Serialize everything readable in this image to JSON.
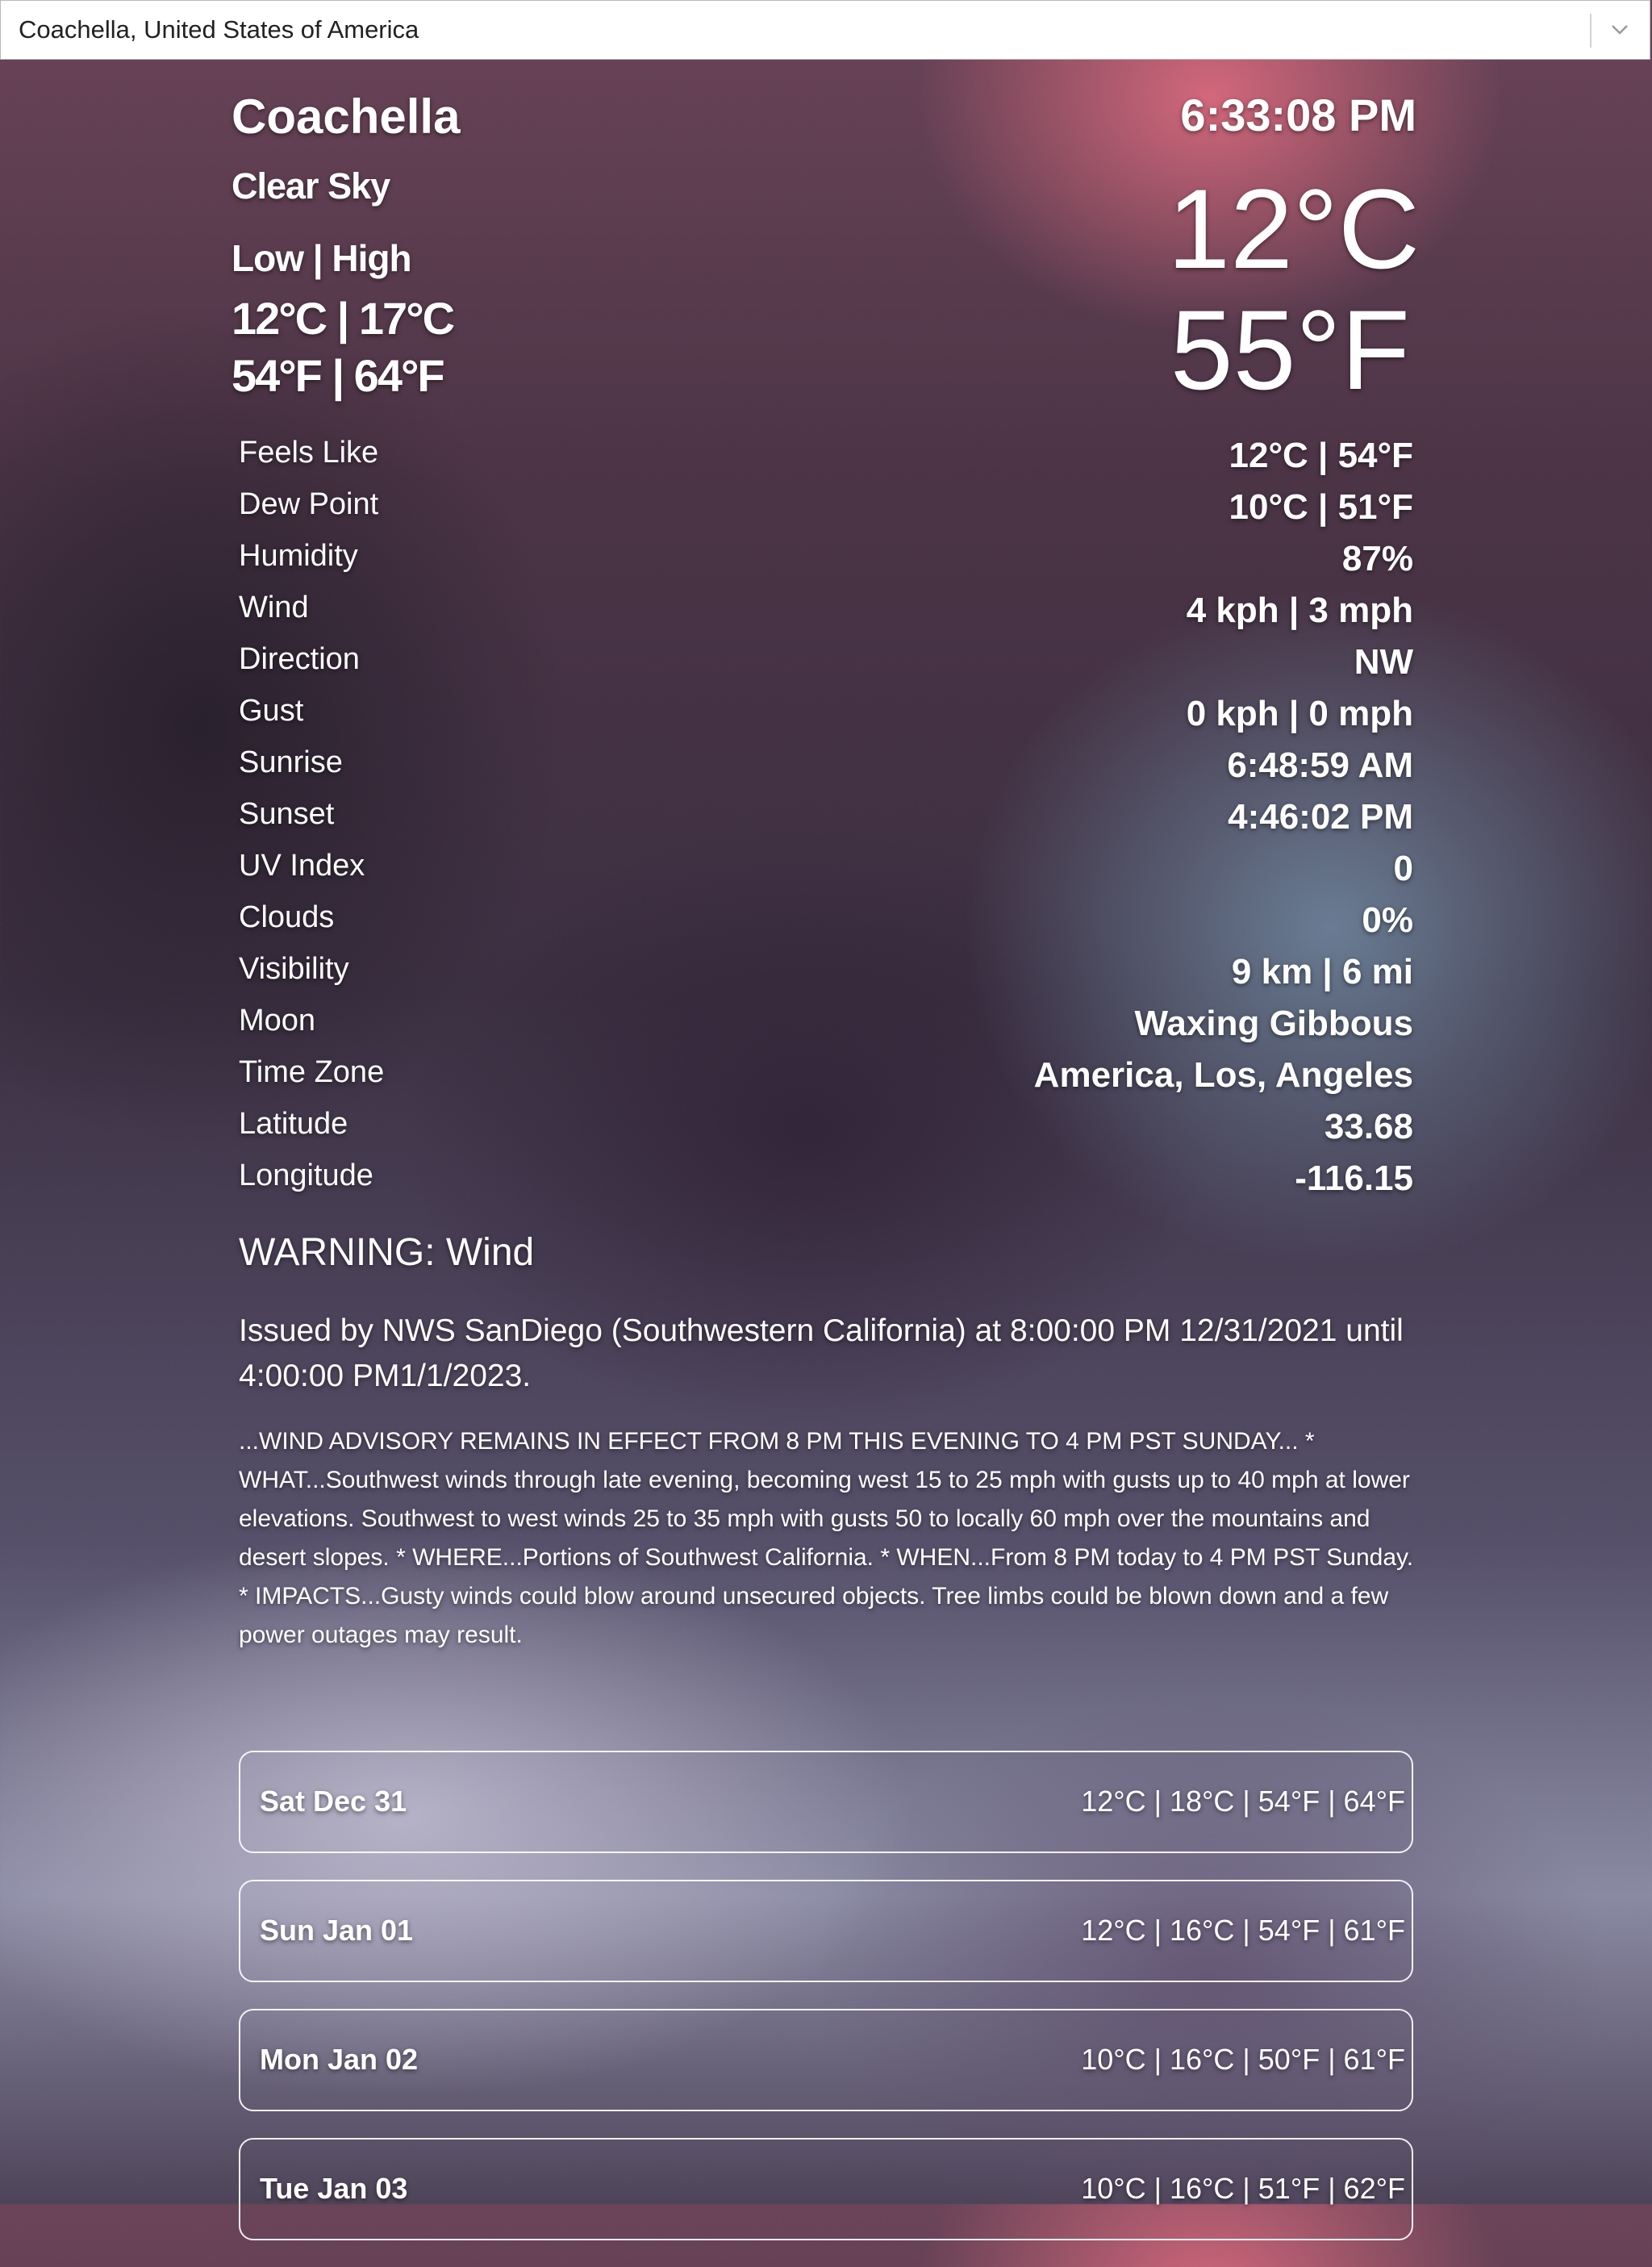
{
  "location_select": {
    "value": "Coachella, United States of America"
  },
  "current": {
    "city": "Coachella",
    "condition": "Clear Sky",
    "low_high_label": "Low | High",
    "low_high_c": "12°C | 17°C",
    "low_high_f": "54°F | 64°F",
    "time": "6:33:08 PM",
    "temp_c": "12°C",
    "temp_f": "55°F"
  },
  "details": [
    {
      "label": "Feels Like",
      "value": "12°C | 54°F"
    },
    {
      "label": "Dew Point",
      "value": "10°C | 51°F"
    },
    {
      "label": "Humidity",
      "value": "87%"
    },
    {
      "label": "Wind",
      "value": "4 kph | 3 mph"
    },
    {
      "label": "Direction",
      "value": "NW"
    },
    {
      "label": "Gust",
      "value": "0 kph | 0 mph"
    },
    {
      "label": "Sunrise",
      "value": "6:48:59 AM"
    },
    {
      "label": "Sunset",
      "value": "4:46:02 PM"
    },
    {
      "label": "UV Index",
      "value": "0"
    },
    {
      "label": "Clouds",
      "value": "0%"
    },
    {
      "label": "Visibility",
      "value": "9 km | 6 mi"
    },
    {
      "label": "Moon",
      "value": "Waxing Gibbous"
    },
    {
      "label": "Time Zone",
      "value": "America, Los, Angeles"
    },
    {
      "label": "Latitude",
      "value": "33.68"
    },
    {
      "label": "Longitude",
      "value": "-116.15"
    }
  ],
  "warning": {
    "title": "WARNING:  Wind",
    "issued": "Issued by NWS SanDiego (Southwestern California) at 8:00:00 PM 12/31/2021 until 4:00:00 PM1/1/2023.",
    "description": "...WIND ADVISORY REMAINS IN EFFECT FROM 8 PM THIS EVENING TO 4 PM PST SUNDAY... * WHAT...Southwest winds through late evening, becoming west 15 to 25 mph with gusts up to 40 mph at lower elevations. Southwest to west winds 25 to 35 mph with gusts 50 to locally 60 mph over the mountains and desert slopes. * WHERE...Portions of Southwest California. * WHEN...From 8 PM today to 4 PM PST Sunday. * IMPACTS...Gusty winds could blow around unsecured objects. Tree limbs could be blown down and a few power outages may result."
  },
  "forecast": [
    {
      "day": "Sat Dec 31",
      "temps": "12°C | 18°C | 54°F | 64°F"
    },
    {
      "day": "Sun Jan 01",
      "temps": "12°C | 16°C | 54°F | 61°F"
    },
    {
      "day": "Mon Jan 02",
      "temps": "10°C | 16°C | 50°F | 61°F"
    },
    {
      "day": "Tue Jan 03",
      "temps": "10°C | 16°C | 51°F | 62°F"
    }
  ]
}
